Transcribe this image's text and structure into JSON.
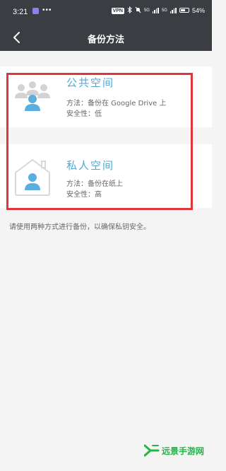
{
  "status_bar": {
    "time": "3:21",
    "more": "•••",
    "vpn": "VPN",
    "net1": "5G",
    "net2": "5G",
    "battery": "54%"
  },
  "header": {
    "title": "备份方法"
  },
  "options": [
    {
      "title": "公共空间",
      "method": "方法：备份在 Google Drive 上",
      "security": "安全性：低",
      "icon": "people-group-icon"
    },
    {
      "title": "私人空间",
      "method": "方法：备份在纸上",
      "security": "安全性：高",
      "icon": "house-person-icon"
    }
  ],
  "hint": "请使用两种方式进行备份，以确保私钥安全。",
  "watermark": {
    "text": "远景手游网"
  },
  "colors": {
    "header_bg": "#3a3d42",
    "accent": "#4fa8d8",
    "highlight": "#e0353a",
    "watermark": "#27b24a"
  }
}
